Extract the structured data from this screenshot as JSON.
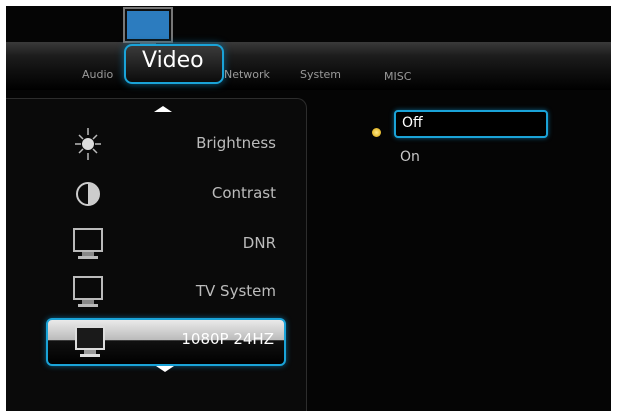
{
  "tabs": [
    {
      "label": "Audio"
    },
    {
      "label": "Video"
    },
    {
      "label": "Network"
    },
    {
      "label": "System"
    },
    {
      "label": "MISC"
    }
  ],
  "menu": {
    "items": [
      {
        "label": "Brightness",
        "icon": "sun-icon"
      },
      {
        "label": "Contrast",
        "icon": "contrast-icon"
      },
      {
        "label": "DNR",
        "icon": "monitor-icon"
      },
      {
        "label": "TV System",
        "icon": "monitor-icon"
      },
      {
        "label": "1080P 24HZ",
        "icon": "monitor-icon",
        "selected": true
      }
    ]
  },
  "options": [
    {
      "label": "Off",
      "selected": true
    },
    {
      "label": "On"
    }
  ],
  "colors": {
    "accent": "#1aa3d8",
    "indicator": "#e8b400"
  }
}
